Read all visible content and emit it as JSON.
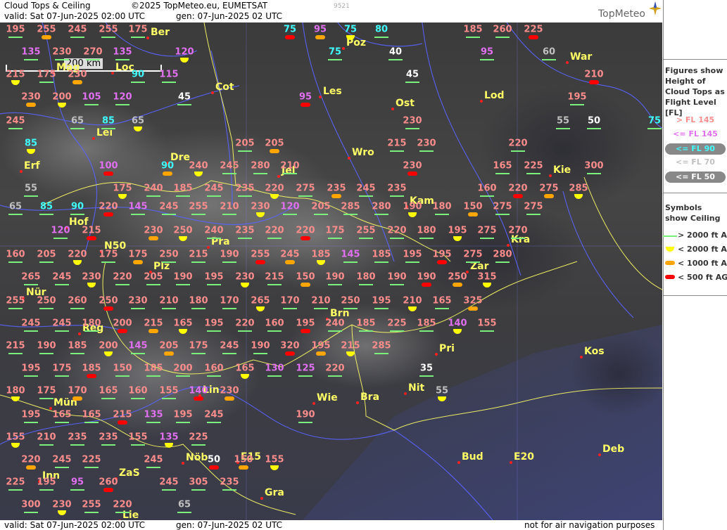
{
  "header": {
    "title": "Cloud Tops & Ceiling",
    "copyright": "©2025 TopMeteo.eu, EUMETSAT",
    "small_code": "9521",
    "valid": "valid:  Sat  07-Jun-2025  02:00 UTC",
    "generated": "gen: 07-Jun-2025 02 UTC",
    "logo": "TopMeteo"
  },
  "footer": {
    "valid": "valid:  Sat  07-Jun-2025  02:00 UTC",
    "generated": "gen: 07-Jun-2025 02 UTC",
    "disclaimer": "not for air navigation purposes"
  },
  "scale_bar": "200 km",
  "legend": {
    "figures_title": "Figures show Height of Cloud Tops as Flight Level  [FL]",
    "figures": [
      {
        "text": "> FL 145",
        "color": "#ff8c8c",
        "bg": ""
      },
      {
        "text": "<= FL 145",
        "color": "#e070f0",
        "bg": ""
      },
      {
        "text": "<= FL 90",
        "color": "#40ffff",
        "bg": "#888888"
      },
      {
        "text": "<= FL 70",
        "color": "#c0c0c0",
        "bg": ""
      },
      {
        "text": "<= FL 50",
        "color": "#ffffff",
        "bg": "#888888"
      }
    ],
    "symbols_title": "Symbols show Ceiling",
    "symbols": [
      {
        "text": "> 2000 ft AGL",
        "kind": "g"
      },
      {
        "text": "< 2000 ft AGL",
        "kind": "y"
      },
      {
        "text": "< 1000 ft AGL",
        "kind": "o"
      },
      {
        "text": "< 500 ft AGL",
        "kind": "r"
      }
    ]
  },
  "colors": {
    "fl_gt145": "#ff8c8c",
    "fl_le145": "#e070f0",
    "fl_le90": "#40ffff",
    "fl_le70": "#c0c0c0",
    "fl_le50": "#ffffff",
    "city": "#ffff66",
    "river": "#5a64ff",
    "border": "#ffff66"
  },
  "cities": [
    "Ber",
    "Poz",
    "War",
    "Mag",
    "Loc",
    "Cot",
    "Les",
    "Lod",
    "Ost",
    "Lei",
    "Wro",
    "Erf",
    "Dre",
    "Jel",
    "Kie",
    "Kam",
    "Hof",
    "Kra",
    "Pra",
    "N50",
    "Plz",
    "Zar",
    "Nür",
    "Brn",
    "Reg",
    "Pri",
    "Kos",
    "Nit",
    "Lin",
    "Wie",
    "Bra",
    "Mün",
    "Bud",
    "Deb",
    "E20",
    "E15",
    "Inn",
    "ZaS",
    "Nöb",
    "Gra",
    "Lie"
  ],
  "labels": [
    "195",
    "255",
    "245",
    "255",
    "175",
    "75",
    "95",
    "75",
    "80",
    "185",
    "260",
    "225",
    "135",
    "230",
    "270",
    "135",
    "120",
    "75",
    "40",
    "95",
    "60",
    "215",
    "175",
    "230",
    "90",
    "115",
    "45",
    "210",
    "230",
    "200",
    "105",
    "120",
    "45",
    "95",
    "195",
    "245",
    "65",
    "85",
    "65",
    "230",
    "55",
    "50",
    "75",
    "85",
    "205",
    "205",
    "215",
    "230",
    "220",
    "100",
    "90",
    "240",
    "245",
    "280",
    "210",
    "230",
    "165",
    "225",
    "300",
    "55",
    "175",
    "240",
    "185",
    "245",
    "235",
    "220",
    "275",
    "235",
    "245",
    "235",
    "160",
    "220",
    "275",
    "285",
    "65",
    "85",
    "90",
    "220",
    "145",
    "245",
    "255",
    "210",
    "230",
    "120",
    "205",
    "285",
    "280",
    "190",
    "180",
    "150",
    "275",
    "275",
    "120",
    "215",
    "230",
    "250",
    "240",
    "235",
    "220",
    "220",
    "175",
    "255",
    "220",
    "180",
    "195",
    "275",
    "270",
    "160",
    "205",
    "220",
    "175",
    "175",
    "250",
    "215",
    "190",
    "255",
    "245",
    "185",
    "145",
    "185",
    "195",
    "195",
    "275",
    "280",
    "265",
    "245",
    "230",
    "220",
    "205",
    "190",
    "195",
    "230",
    "215",
    "150",
    "190",
    "180",
    "190",
    "190",
    "250",
    "315",
    "255",
    "250",
    "260",
    "250",
    "230",
    "210",
    "180",
    "170",
    "265",
    "170",
    "210",
    "250",
    "195",
    "210",
    "165",
    "325",
    "245",
    "245",
    "180",
    "200",
    "215",
    "165",
    "195",
    "220",
    "160",
    "195",
    "240",
    "185",
    "225",
    "185",
    "140",
    "155",
    "215",
    "190",
    "185",
    "200",
    "145",
    "205",
    "175",
    "245",
    "190",
    "320",
    "195",
    "215",
    "285",
    "195",
    "175",
    "185",
    "150",
    "185",
    "200",
    "160",
    "165",
    "130",
    "125",
    "220",
    "35",
    "180",
    "175",
    "170",
    "165",
    "160",
    "155",
    "140",
    "230",
    "55",
    "195",
    "165",
    "165",
    "215",
    "135",
    "195",
    "245",
    "190",
    "155",
    "210",
    "235",
    "235",
    "155",
    "135",
    "225",
    "220",
    "245",
    "225",
    "245",
    "50",
    "150",
    "155",
    "225",
    "195",
    "95",
    "260",
    "245",
    "305",
    "235",
    "300",
    "230",
    "255",
    "220",
    "65"
  ]
}
